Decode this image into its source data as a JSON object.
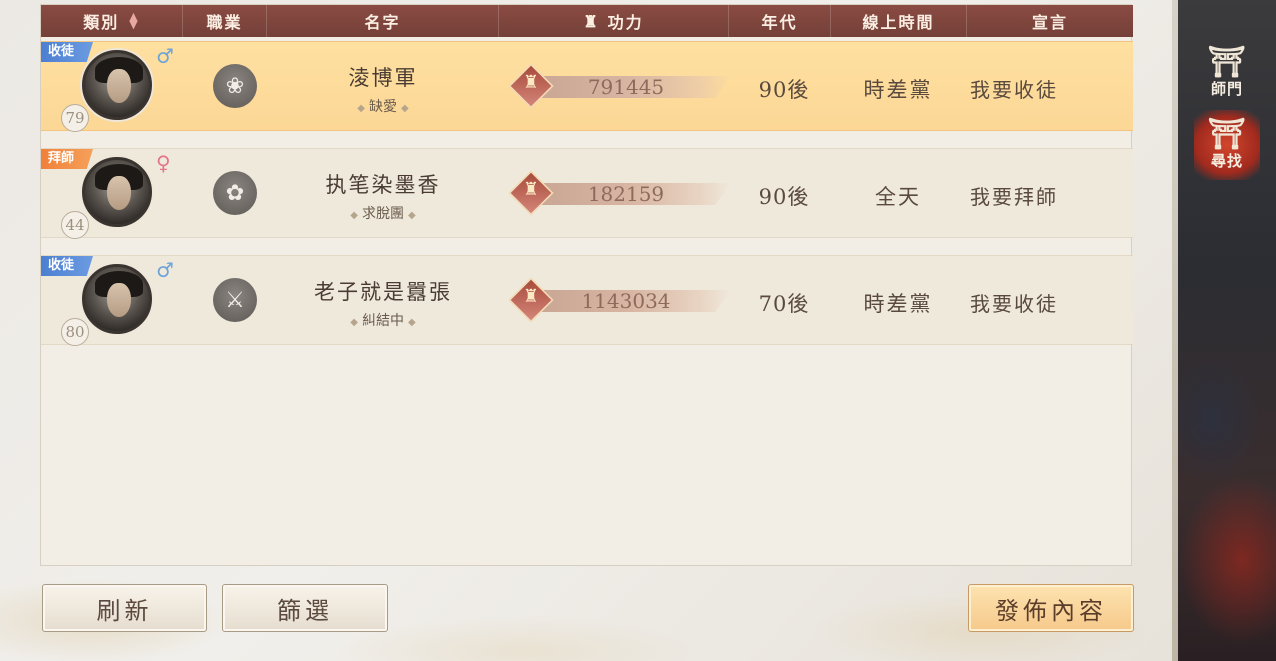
{
  "header": {
    "col_type": "類別",
    "col_job": "職業",
    "col_name": "名字",
    "col_power": "功力",
    "col_era": "年代",
    "col_online": "線上時間",
    "col_decl": "宣言"
  },
  "side_tabs": [
    {
      "label": "師門",
      "icon": "gate-icon",
      "active": false
    },
    {
      "label": "尋找",
      "icon": "gate-icon",
      "active": true
    }
  ],
  "rows": [
    {
      "tag": "收徒",
      "tag_color": "#4d7fd2",
      "gender": "♂",
      "level": "79",
      "job_icon": "lotus-crest-icon",
      "name": "淩博軍",
      "status": "缺愛",
      "power": "791445",
      "era": "90後",
      "online": "時差黨",
      "declaration": "我要收徒",
      "selected": true
    },
    {
      "tag": "拜師",
      "tag_color": "#f0813a",
      "gender": "♀",
      "level": "44",
      "job_icon": "lotus-flower-icon",
      "name": "执笔染墨香",
      "status": "求脫團",
      "power": "182159",
      "era": "90後",
      "online": "全天",
      "declaration": "我要拜師",
      "selected": false
    },
    {
      "tag": "收徒",
      "tag_color": "#4d7fd2",
      "gender": "♂",
      "level": "80",
      "job_icon": "gourd-sword-icon",
      "name": "老子就是囂張",
      "status": "糾結中",
      "power": "1143034",
      "era": "70後",
      "online": "時差黨",
      "declaration": "我要收徒",
      "selected": false
    }
  ],
  "buttons": {
    "refresh": "刷新",
    "filter": "篩選",
    "publish": "發佈內容"
  },
  "colors": {
    "header_bg": "#744038",
    "selected_row": "#fcd796",
    "tag_blue": "#4d7fd2",
    "tag_orange": "#f0813a"
  }
}
